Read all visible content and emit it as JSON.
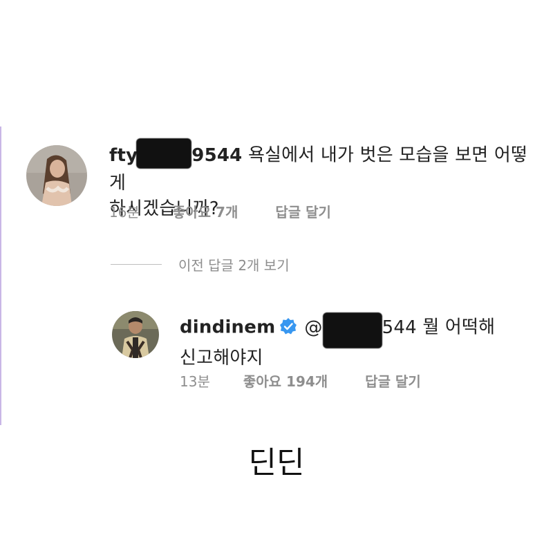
{
  "comment": {
    "username_visible": "fty",
    "username_suffix": "9544",
    "text_line1": "욕실에서 내가 벗은 모습을 보면 어떻게",
    "text_line2": "하시겠습니까?",
    "time": "16분",
    "likes": "좋아요 7개",
    "reply_label": "답글 달기"
  },
  "view_previous": "이전 답글 2개 보기",
  "reply": {
    "username": "dindinem",
    "mention_prefix": "@",
    "mention_suffix": "544",
    "text_line1": "뭘 어떡해",
    "text_line2": "신고해야지",
    "time": "13분",
    "likes": "좋아요 194개",
    "reply_label": "답글 달기"
  },
  "caption": "딘딘",
  "colors": {
    "meta_gray": "#8e8e8e",
    "verified_blue": "#3897f0",
    "accent_bar": "#c9b7e6"
  }
}
